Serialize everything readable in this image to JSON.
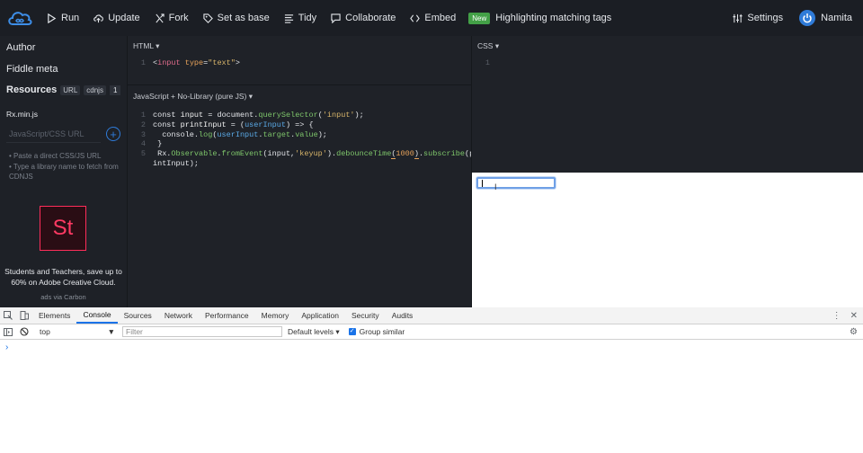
{
  "topbar": {
    "buttons": [
      {
        "label": "Run",
        "icon": "play-icon"
      },
      {
        "label": "Update",
        "icon": "cloud-upload-icon"
      },
      {
        "label": "Fork",
        "icon": "fork-icon"
      },
      {
        "label": "Set as base",
        "icon": "tag-icon"
      },
      {
        "label": "Tidy",
        "icon": "lines-icon"
      },
      {
        "label": "Collaborate",
        "icon": "chat-icon"
      },
      {
        "label": "Embed",
        "icon": "code-icon"
      }
    ],
    "new_badge": "New",
    "announcement": "Highlighting matching tags",
    "settings_label": "Settings",
    "user_name": "Namita"
  },
  "sidebar": {
    "author": "Author",
    "fiddle_meta": "Fiddle meta",
    "resources_title": "Resources",
    "chip_url": "URL",
    "chip_cdnjs": "cdnjs",
    "resource_count": "1",
    "resource_file": "Rx.min.js",
    "url_placeholder": "JavaScript/CSS URL",
    "hints": [
      "Paste a direct CSS/JS URL",
      "Type a library name to fetch from CDNJS"
    ],
    "ad_logo": "St",
    "ad_text": "Students and Teachers, save up to 60% on Adobe Creative Cloud.",
    "ad_via": "ads via Carbon"
  },
  "html_pane": {
    "title": "HTML ▾",
    "line_numbers": [
      "1"
    ]
  },
  "js_pane": {
    "title": "JavaScript + No-Library (pure JS) ▾",
    "line_numbers": [
      "1",
      "2",
      "3",
      "4",
      "5",
      ""
    ]
  },
  "css_pane": {
    "title": "CSS ▾",
    "line_numbers": [
      "1"
    ]
  },
  "devtools": {
    "tabs": [
      "Elements",
      "Console",
      "Sources",
      "Network",
      "Performance",
      "Memory",
      "Application",
      "Security",
      "Audits"
    ],
    "active_tab": "Console",
    "context": "top",
    "filter_placeholder": "Filter",
    "levels": "Default levels ▾",
    "group_similar": "Group similar",
    "prompt": "›"
  },
  "colors": {
    "accent": "#2f7bd8",
    "new_badge": "#43a047",
    "adobe": "#ff2d5a"
  }
}
